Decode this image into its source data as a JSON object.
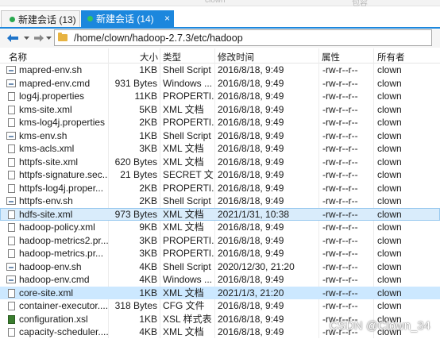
{
  "tabs": [
    {
      "label": "新建会话 (13)",
      "active": false
    },
    {
      "label": "新建会话 (14)",
      "active": true
    }
  ],
  "tab_close_icon": "×",
  "top_faint_text": [
    "clown",
    "包容"
  ],
  "nav": {
    "back_icon": "back-arrow-icon",
    "forward_icon": "forward-arrow-icon",
    "dropdown_icon": "chevron-down-icon",
    "path": "/home/clown/hadoop-2.7.3/etc/hadoop"
  },
  "columns": {
    "name": "名称",
    "size": "大小",
    "type": "类型",
    "modified": "修改时间",
    "permissions": "属性",
    "owner": "所有者"
  },
  "files": [
    {
      "name": "mapred-env.sh",
      "size": "1KB",
      "type": "Shell Script",
      "modified": "2016/8/18, 9:49",
      "perm": "-rw-r--r--",
      "owner": "clown",
      "icon": "script-icon"
    },
    {
      "name": "mapred-env.cmd",
      "size": "931 Bytes",
      "type": "Windows ...",
      "modified": "2016/8/18, 9:49",
      "perm": "-rw-r--r--",
      "owner": "clown",
      "icon": "script-icon"
    },
    {
      "name": "log4j.properties",
      "size": "11KB",
      "type": "PROPERTI...",
      "modified": "2016/8/18, 9:49",
      "perm": "-rw-r--r--",
      "owner": "clown",
      "icon": "document-icon"
    },
    {
      "name": "kms-site.xml",
      "size": "5KB",
      "type": "XML 文档",
      "modified": "2016/8/18, 9:49",
      "perm": "-rw-r--r--",
      "owner": "clown",
      "icon": "document-icon"
    },
    {
      "name": "kms-log4j.properties",
      "size": "2KB",
      "type": "PROPERTI...",
      "modified": "2016/8/18, 9:49",
      "perm": "-rw-r--r--",
      "owner": "clown",
      "icon": "document-icon"
    },
    {
      "name": "kms-env.sh",
      "size": "1KB",
      "type": "Shell Script",
      "modified": "2016/8/18, 9:49",
      "perm": "-rw-r--r--",
      "owner": "clown",
      "icon": "script-icon"
    },
    {
      "name": "kms-acls.xml",
      "size": "3KB",
      "type": "XML 文档",
      "modified": "2016/8/18, 9:49",
      "perm": "-rw-r--r--",
      "owner": "clown",
      "icon": "document-icon"
    },
    {
      "name": "httpfs-site.xml",
      "size": "620 Bytes",
      "type": "XML 文档",
      "modified": "2016/8/18, 9:49",
      "perm": "-rw-r--r--",
      "owner": "clown",
      "icon": "document-icon"
    },
    {
      "name": "httpfs-signature.sec...",
      "size": "21 Bytes",
      "type": "SECRET 文...",
      "modified": "2016/8/18, 9:49",
      "perm": "-rw-r--r--",
      "owner": "clown",
      "icon": "document-icon"
    },
    {
      "name": "httpfs-log4j.proper...",
      "size": "2KB",
      "type": "PROPERTI...",
      "modified": "2016/8/18, 9:49",
      "perm": "-rw-r--r--",
      "owner": "clown",
      "icon": "document-icon"
    },
    {
      "name": "httpfs-env.sh",
      "size": "2KB",
      "type": "Shell Script",
      "modified": "2016/8/18, 9:49",
      "perm": "-rw-r--r--",
      "owner": "clown",
      "icon": "script-icon"
    },
    {
      "name": "hdfs-site.xml",
      "size": "973 Bytes",
      "type": "XML 文档",
      "modified": "2021/1/31, 10:38",
      "perm": "-rw-r--r--",
      "owner": "clown",
      "icon": "document-icon",
      "selected": true,
      "focus": true
    },
    {
      "name": "hadoop-policy.xml",
      "size": "9KB",
      "type": "XML 文档",
      "modified": "2016/8/18, 9:49",
      "perm": "-rw-r--r--",
      "owner": "clown",
      "icon": "document-icon"
    },
    {
      "name": "hadoop-metrics2.pr...",
      "size": "3KB",
      "type": "PROPERTI...",
      "modified": "2016/8/18, 9:49",
      "perm": "-rw-r--r--",
      "owner": "clown",
      "icon": "document-icon"
    },
    {
      "name": "hadoop-metrics.pr...",
      "size": "3KB",
      "type": "PROPERTI...",
      "modified": "2016/8/18, 9:49",
      "perm": "-rw-r--r--",
      "owner": "clown",
      "icon": "document-icon"
    },
    {
      "name": "hadoop-env.sh",
      "size": "4KB",
      "type": "Shell Script",
      "modified": "2020/12/30, 21:20",
      "perm": "-rw-r--r--",
      "owner": "clown",
      "icon": "script-icon"
    },
    {
      "name": "hadoop-env.cmd",
      "size": "4KB",
      "type": "Windows ...",
      "modified": "2016/8/18, 9:49",
      "perm": "-rw-r--r--",
      "owner": "clown",
      "icon": "script-icon"
    },
    {
      "name": "core-site.xml",
      "size": "1KB",
      "type": "XML 文档",
      "modified": "2021/1/3, 21:20",
      "perm": "-rw-r--r--",
      "owner": "clown",
      "icon": "document-icon",
      "selected": true
    },
    {
      "name": "container-executor....",
      "size": "318 Bytes",
      "type": "CFG 文件",
      "modified": "2016/8/18, 9:49",
      "perm": "-rw-r--r--",
      "owner": "clown",
      "icon": "document-icon"
    },
    {
      "name": "configuration.xsl",
      "size": "1KB",
      "type": "XSL 样式表",
      "modified": "2016/8/18, 9:49",
      "perm": "-rw-r--r--",
      "owner": "clown",
      "icon": "xsl-icon"
    },
    {
      "name": "capacity-scheduler....",
      "size": "4KB",
      "type": "XML 文档",
      "modified": "2016/8/18, 9:49",
      "perm": "-rw-r--r--",
      "owner": "clown",
      "icon": "document-icon"
    }
  ],
  "watermark": "CSDN @Clown_34",
  "colors": {
    "accent": "#1c87dd",
    "selection": "#cce8ff",
    "folder": "#e7b341"
  }
}
